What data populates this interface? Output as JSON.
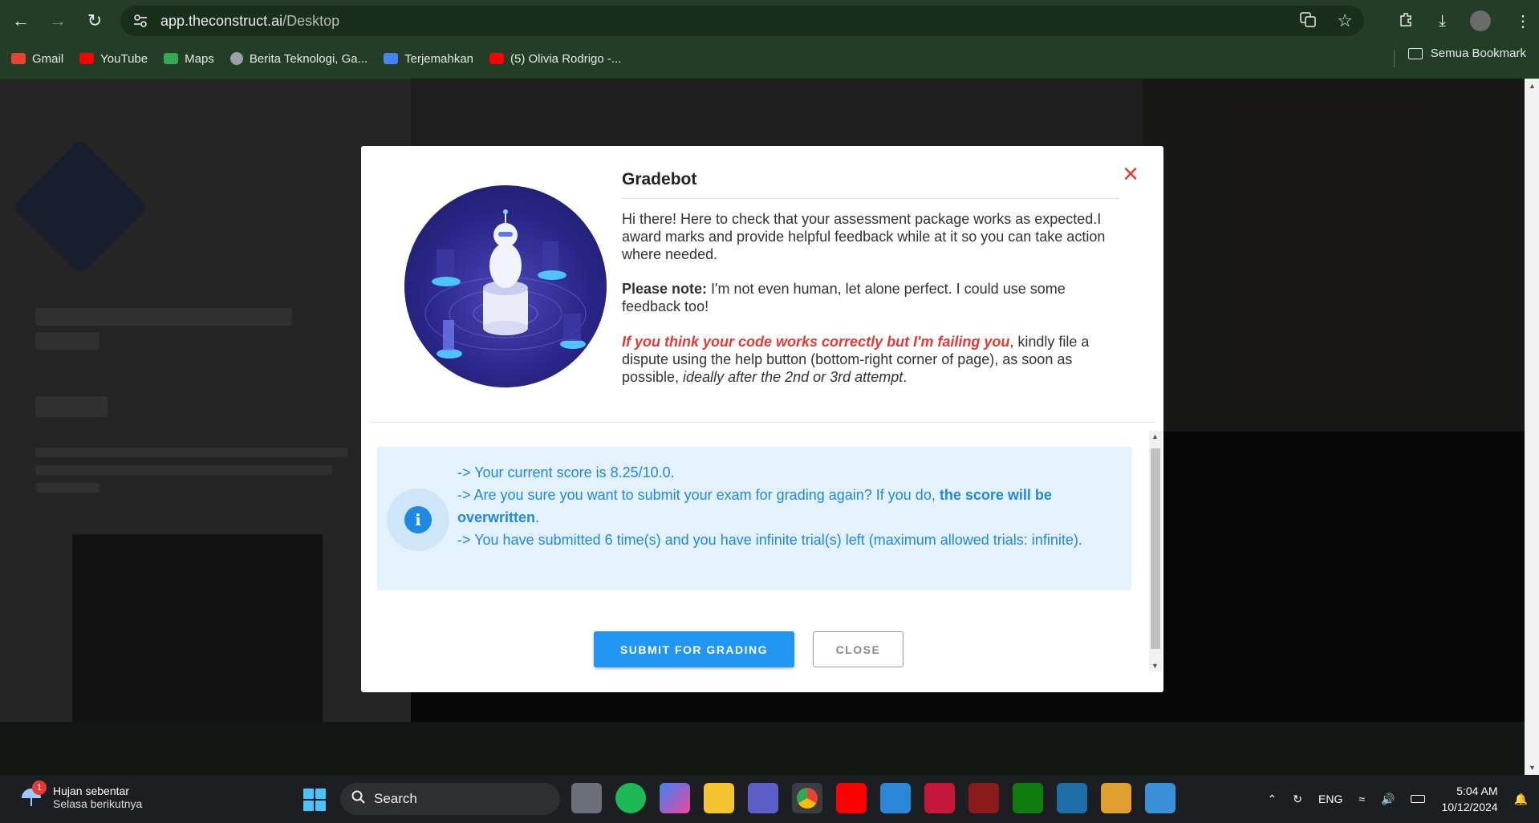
{
  "browser": {
    "url_host": "app.theconstruct.ai",
    "url_path": "/Desktop",
    "bookmarks": [
      {
        "label": "Gmail",
        "color": "#ea4335"
      },
      {
        "label": "YouTube",
        "color": "#ff0000"
      },
      {
        "label": "Maps",
        "color": "#34a853"
      },
      {
        "label": "Berita Teknologi, Ga...",
        "color": "#9aa0a6"
      },
      {
        "label": "Terjemahkan",
        "color": "#4285f4"
      },
      {
        "label": "(5) Olivia Rodrigo -...",
        "color": "#ff0000"
      }
    ],
    "all_bookmarks": "Semua Bookmark"
  },
  "modal": {
    "title": "Gradebot",
    "intro": "Hi there! Here to check that your assessment package works as expected.I award marks and provide helpful feedback while at it so you can take action where needed.",
    "note_label": "Please note:",
    "note_text": " I'm not even human, let alone perfect. I could use some feedback too!",
    "dispute_emph": "If you think your code works correctly but I'm failing you",
    "dispute_text": ", kindly file a dispute using the help button (bottom-right corner of page), as soon as possible, ",
    "dispute_italic": "ideally after the 2nd or 3rd attempt",
    "dispute_end": ".",
    "info_line1": "-> Your current score is 8.25/10.0.",
    "info_line2_a": "->  Are you sure you want to submit your exam for grading again? If you do, ",
    "info_line2_b": "the score will be overwritten",
    "info_line2_c": ".",
    "info_line3": "-> You have submitted 6 time(s) and you have infinite trial(s) left (maximum allowed trials: infinite).",
    "submit_label": "SUBMIT FOR GRADING",
    "close_label": "CLOSE",
    "close_icon": "×",
    "info_icon": "i"
  },
  "taskbar": {
    "weather_title": "Hujan sebentar",
    "weather_sub": "Selasa berikutnya",
    "weather_badge": "1",
    "search_label": "Search",
    "lang": "ENG",
    "time": "5:04 AM",
    "date": "10/12/2024"
  }
}
